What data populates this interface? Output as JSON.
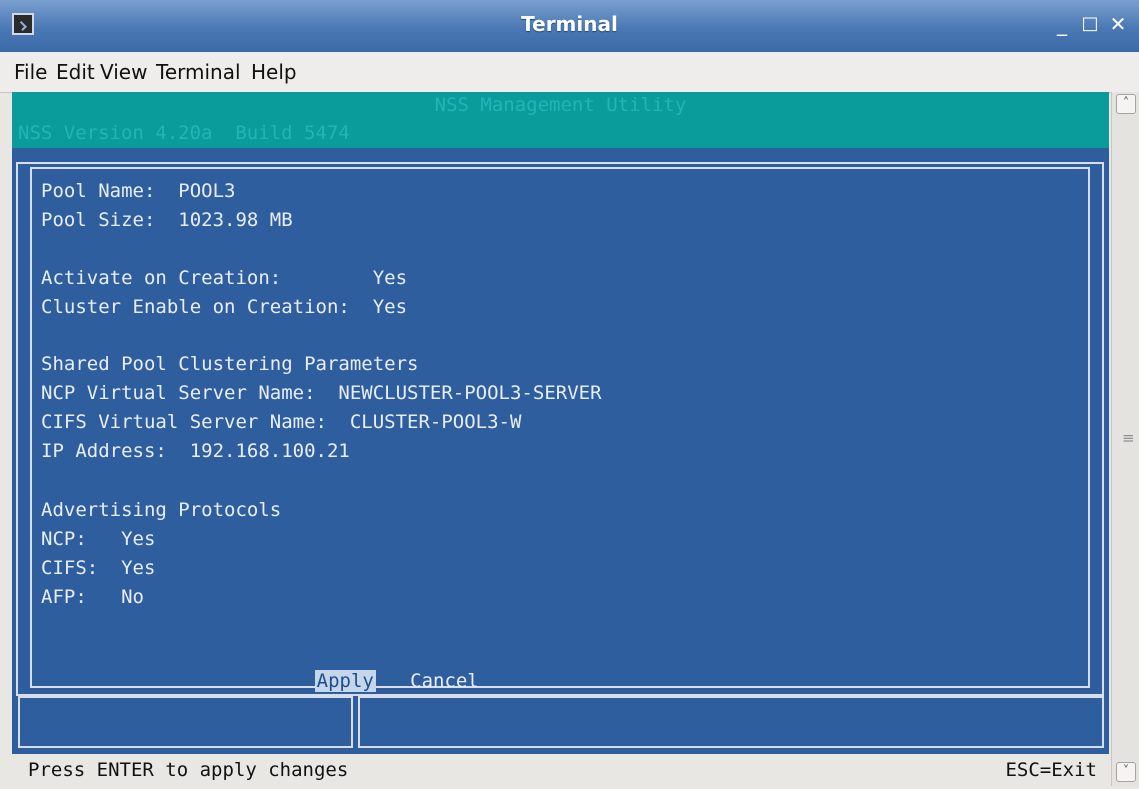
{
  "window": {
    "title": "Terminal",
    "controls": {
      "minimize": "_",
      "maximize": "□",
      "close": "✕"
    }
  },
  "menubar": [
    "File",
    "Edit",
    "View",
    "Terminal",
    "Help"
  ],
  "header": {
    "title": "NSS Management Utility",
    "version": "NSS Version 4.20a  Build 5474"
  },
  "dialog": {
    "pool_name": "Pool Name:  POOL3",
    "pool_size": "Pool Size:  1023.98 MB",
    "activate": "Activate on Creation:        Yes",
    "cluster_enable": "Cluster Enable on Creation:  Yes",
    "section_title": "Shared Pool Clustering Parameters",
    "ncp_server": "NCP Virtual Server Name:  NEWCLUSTER-POOL3-SERVER",
    "cifs_server": "CIFS Virtual Server Name:  CLUSTER-POOL3-W",
    "ip": "IP Address:  192.168.100.21",
    "advert_title": "Advertising Protocols",
    "ncp": "NCP:   Yes",
    "cifs": "CIFS:  Yes",
    "afp": "AFP:   No",
    "apply": "Apply",
    "cancel": "Cancel"
  },
  "statusbar": {
    "left": "Press ENTER to apply changes",
    "right": "ESC=Exit"
  },
  "icons": [
    "terminal-app-icon",
    "scroll-up-arrow-icon",
    "scroll-down-arrow-icon"
  ]
}
